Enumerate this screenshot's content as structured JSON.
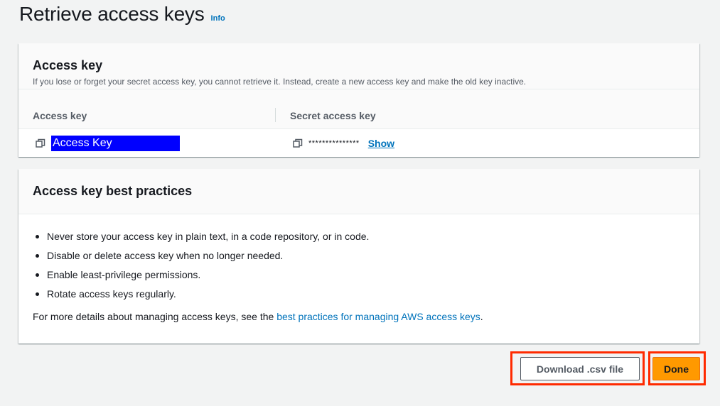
{
  "header": {
    "title": "Retrieve access keys",
    "info_label": "Info"
  },
  "access_key_card": {
    "title": "Access key",
    "description": "If you lose or forget your secret access key, you cannot retrieve it. Instead, create a new access key and make the old key inactive.",
    "columns": [
      "Access key",
      "Secret access key"
    ],
    "access_key_value": "Access Key",
    "secret_mask": "***************",
    "show_label": "Show"
  },
  "best_practices_card": {
    "title": "Access key best practices",
    "items": [
      "Never store your access key in plain text, in a code repository, or in code.",
      "Disable or delete access key when no longer needed.",
      "Enable least-privilege permissions.",
      "Rotate access keys regularly."
    ],
    "footnote_prefix": "For more details about managing access keys, see the ",
    "footnote_link": "best practices for managing AWS access keys",
    "footnote_suffix": "."
  },
  "actions": {
    "download_label": "Download .csv file",
    "done_label": "Done"
  },
  "colors": {
    "primary_button": "#ff9900",
    "link": "#0073bb",
    "highlight_box": "#ff2a00",
    "key_selection": "#0000ff"
  }
}
